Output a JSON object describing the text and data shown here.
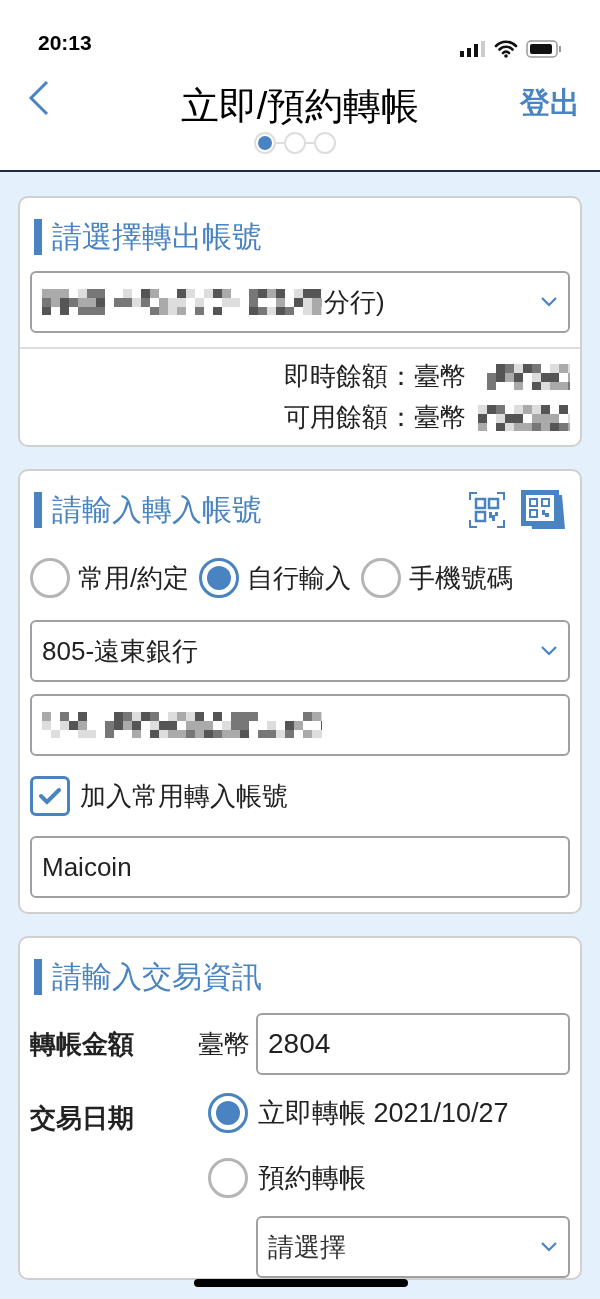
{
  "status_bar": {
    "time": "20:13"
  },
  "header": {
    "title": "立即/預約轉帳",
    "logout": "登出",
    "steps": [
      {
        "selected": true
      },
      {
        "selected": false
      },
      {
        "selected": false
      }
    ]
  },
  "from_account": {
    "title": "請選擇轉出帳號",
    "account": {
      "masked": true,
      "text": "分行)"
    },
    "balances": [
      {
        "label": "即時餘額：臺幣",
        "masked": true
      },
      {
        "label": "可用餘額：臺幣",
        "masked": true
      }
    ]
  },
  "to_account": {
    "title": "請輸入轉入帳號",
    "modes": [
      {
        "label": "常用/約定",
        "selected": false
      },
      {
        "label": "自行輸入",
        "selected": true
      },
      {
        "label": "手機號碼",
        "selected": false
      }
    ],
    "bank": "805-遠東銀行",
    "account_number": {
      "masked": true
    },
    "save_favorite": {
      "label": "加入常用轉入帳號",
      "checked": true
    },
    "nickname": "Maicoin"
  },
  "transaction": {
    "title": "請輸入交易資訊",
    "amount_label": "轉帳金額",
    "currency": "臺幣",
    "amount": "2804",
    "date_label": "交易日期",
    "date_options": [
      {
        "label": "立即轉帳 2021/10/27",
        "selected": true
      },
      {
        "label": "預約轉帳",
        "selected": false
      }
    ],
    "schedule_placeholder": "請選擇"
  }
}
